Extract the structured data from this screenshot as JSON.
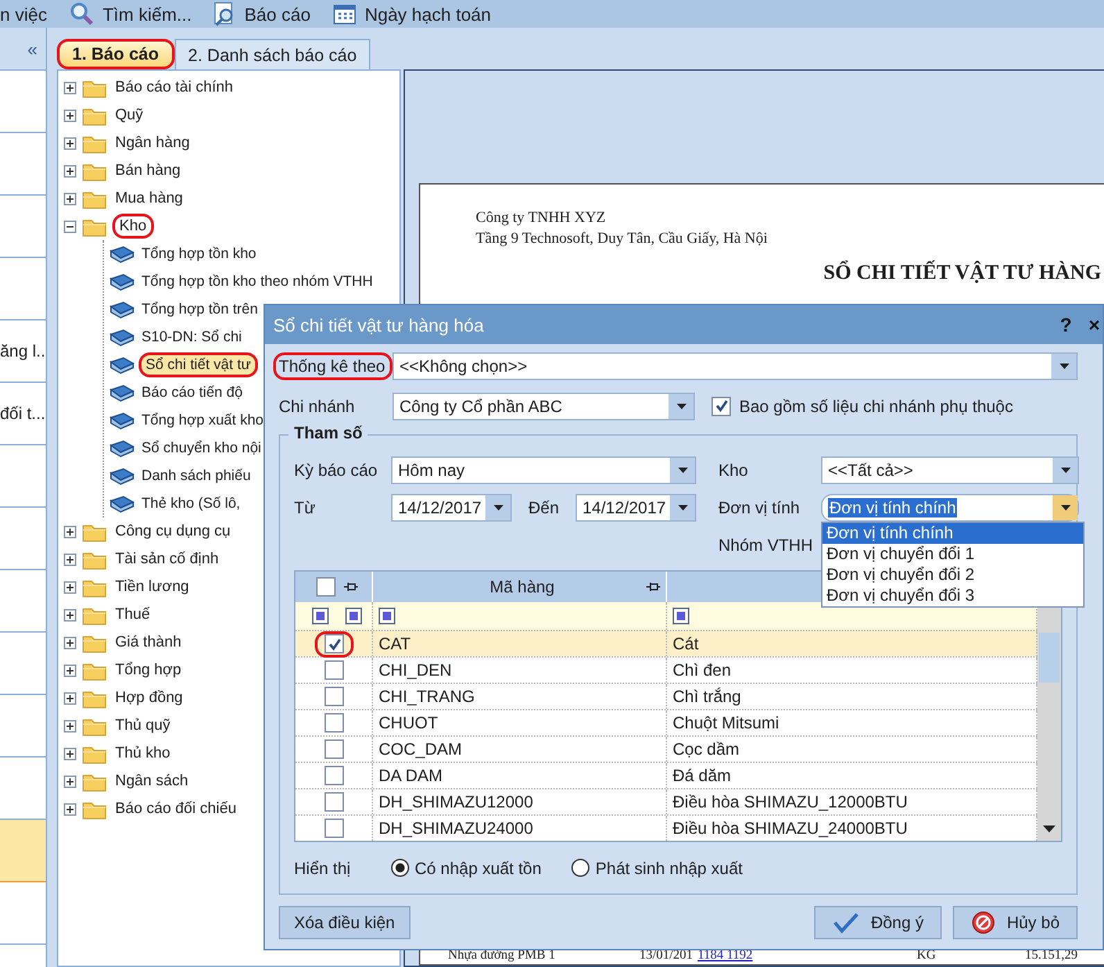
{
  "toolbar": {
    "items": [
      {
        "kind": "text",
        "label": "n việc"
      },
      {
        "kind": "search",
        "label": "Tìm kiếm..."
      },
      {
        "kind": "report",
        "label": "Báo cáo"
      },
      {
        "kind": "calendar",
        "label": "Ngày hạch toán"
      }
    ]
  },
  "left_panel": {
    "collapse_button": "«",
    "items": [
      {
        "selected": false
      },
      {
        "selected": false
      },
      {
        "selected": false
      },
      {
        "selected": false
      },
      {
        "label": "ăng l...",
        "selected": false
      },
      {
        "label": "đối t...",
        "selected": false
      },
      {
        "selected": false
      },
      {
        "selected": false
      },
      {
        "selected": false
      },
      {
        "selected": false
      },
      {
        "selected": false
      },
      {
        "selected": false
      },
      {
        "selected": true
      },
      {
        "selected": false
      }
    ]
  },
  "tabs": [
    {
      "label": "1. Báo cáo",
      "selected": true,
      "highlighted": true
    },
    {
      "label": "2. Danh sách báo cáo",
      "selected": false,
      "highlighted": false
    }
  ],
  "tree": [
    {
      "label": "Báo cáo tài chính",
      "expanded": false,
      "highlighted": false
    },
    {
      "label": "Quỹ",
      "expanded": false,
      "highlighted": false
    },
    {
      "label": "Ngân hàng",
      "expanded": false,
      "highlighted": false
    },
    {
      "label": "Bán hàng",
      "expanded": false,
      "highlighted": false
    },
    {
      "label": "Mua hàng",
      "expanded": false,
      "highlighted": false
    },
    {
      "label": "Kho",
      "expanded": true,
      "highlighted": true,
      "children": [
        {
          "label": "Tổng hợp tồn kho",
          "selected": false,
          "highlighted": false
        },
        {
          "label": "Tổng hợp tồn kho theo nhóm VTHH",
          "selected": false,
          "highlighted": false
        },
        {
          "label": "Tổng hợp tồn trên",
          "selected": false,
          "highlighted": false
        },
        {
          "label": "S10-DN: Sổ chi",
          "selected": false,
          "highlighted": false
        },
        {
          "label": "Sổ chi tiết vật tư",
          "selected": true,
          "highlighted": true
        },
        {
          "label": "Báo cáo tiến độ",
          "selected": false,
          "highlighted": false
        },
        {
          "label": "Tổng hợp xuất kho",
          "selected": false,
          "highlighted": false
        },
        {
          "label": "Sổ chuyển kho nội",
          "selected": false,
          "highlighted": false
        },
        {
          "label": "Danh sách phiếu",
          "selected": false,
          "highlighted": false
        },
        {
          "label": "Thẻ kho (Số lô,",
          "selected": false,
          "highlighted": false
        }
      ]
    },
    {
      "label": "Công cụ dụng cụ",
      "expanded": false,
      "highlighted": false
    },
    {
      "label": "Tài sản cố định",
      "expanded": false,
      "highlighted": false
    },
    {
      "label": "Tiền lương",
      "expanded": false,
      "highlighted": false
    },
    {
      "label": "Thuế",
      "expanded": false,
      "highlighted": false
    },
    {
      "label": "Giá thành",
      "expanded": false,
      "highlighted": false
    },
    {
      "label": "Tổng hợp",
      "expanded": false,
      "highlighted": false
    },
    {
      "label": "Hợp đồng",
      "expanded": false,
      "highlighted": false
    },
    {
      "label": "Thủ quỹ",
      "expanded": false,
      "highlighted": false
    },
    {
      "label": "Thủ kho",
      "expanded": false,
      "highlighted": false
    },
    {
      "label": "Ngân sách",
      "expanded": false,
      "highlighted": false
    },
    {
      "label": "Báo cáo đối chiếu",
      "expanded": false,
      "highlighted": false
    }
  ],
  "preview": {
    "company": "Công ty TNHH XYZ",
    "address": "Tầng 9 Technosoft, Duy Tân, Cầu Giấy, Hà Nội",
    "title": "SỔ CHI TIẾT VẬT TƯ HÀNG",
    "table_row": [
      {
        "kind": "text",
        "text": "Nhựa đường PMB 1"
      },
      {
        "kind": "text",
        "text": "13/01/201"
      },
      {
        "kind": "link",
        "text": "1184 1192"
      },
      {
        "kind": "text",
        "text": "KG"
      },
      {
        "kind": "text",
        "text": "15.151,29"
      }
    ]
  },
  "dialog": {
    "title": "Sổ chi tiết vật tư hàng hóa",
    "help_button": "?",
    "close_button": "×",
    "group_by": {
      "label": "Thống kê theo",
      "value": "<<Không chọn>>",
      "highlighted": true
    },
    "branch": {
      "label": "Chi nhánh",
      "value": "Công ty Cổ phần ABC"
    },
    "include_branches": {
      "label": "Bao gồm số liệu chi nhánh phụ thuộc",
      "checked": true
    },
    "params": {
      "title": "Tham số",
      "period": {
        "label": "Kỳ báo cáo",
        "value": "Hôm nay"
      },
      "from": {
        "label": "Từ",
        "value": "14/12/2017"
      },
      "to": {
        "label": "Đến",
        "value": "14/12/2017"
      },
      "warehouse": {
        "label": "Kho",
        "value": "<<Tất cả>>"
      },
      "unit": {
        "label": "Đơn vị tính",
        "value": "Đơn vị tính chính",
        "highlighted": true,
        "expanded": true,
        "options": [
          {
            "label": "Đơn vị tính chính",
            "selected": true
          },
          {
            "label": "Đơn vị chuyển đổi 1",
            "selected": false
          },
          {
            "label": "Đơn vị chuyển đổi 2",
            "selected": false
          },
          {
            "label": "Đơn vị chuyển đổi 3",
            "selected": false
          }
        ]
      },
      "item_group": {
        "label": "Nhóm VTHH"
      },
      "grid": {
        "select_all_checked": false,
        "code_header": "Mã hàng",
        "rows": [
          {
            "code": "CAT",
            "name": "Cát",
            "checked": true,
            "selected": true,
            "highlighted": true
          },
          {
            "code": "CHI_DEN",
            "name": "Chì đen",
            "checked": false,
            "selected": false,
            "highlighted": false
          },
          {
            "code": "CHI_TRANG",
            "name": "Chì trắng",
            "checked": false,
            "selected": false,
            "highlighted": false
          },
          {
            "code": "CHUOT",
            "name": "Chuột Mitsumi",
            "checked": false,
            "selected": false,
            "highlighted": false
          },
          {
            "code": "COC_DAM",
            "name": "Cọc dầm",
            "checked": false,
            "selected": false,
            "highlighted": false
          },
          {
            "code": "DA DAM",
            "name": "Đá dăm",
            "checked": false,
            "selected": false,
            "highlighted": false
          },
          {
            "code": "DH_SHIMAZU12000",
            "name": "Điều hòa SHIMAZU_12000BTU",
            "checked": false,
            "selected": false,
            "highlighted": false
          },
          {
            "code": "DH_SHIMAZU24000",
            "name": "Điều hòa SHIMAZU_24000BTU",
            "checked": false,
            "selected": false,
            "highlighted": false
          }
        ]
      },
      "display": {
        "label": "Hiển thị",
        "options": [
          {
            "label": "Có nhập xuất tồn",
            "selected": true
          },
          {
            "label": "Phát sinh nhập xuất",
            "selected": false
          }
        ]
      }
    },
    "buttons": [
      {
        "kind": "clear",
        "label": "Xóa điều kiện"
      },
      {
        "kind": "ok",
        "label": "Đồng ý"
      },
      {
        "kind": "cancel",
        "label": "Hủy bỏ"
      }
    ]
  }
}
